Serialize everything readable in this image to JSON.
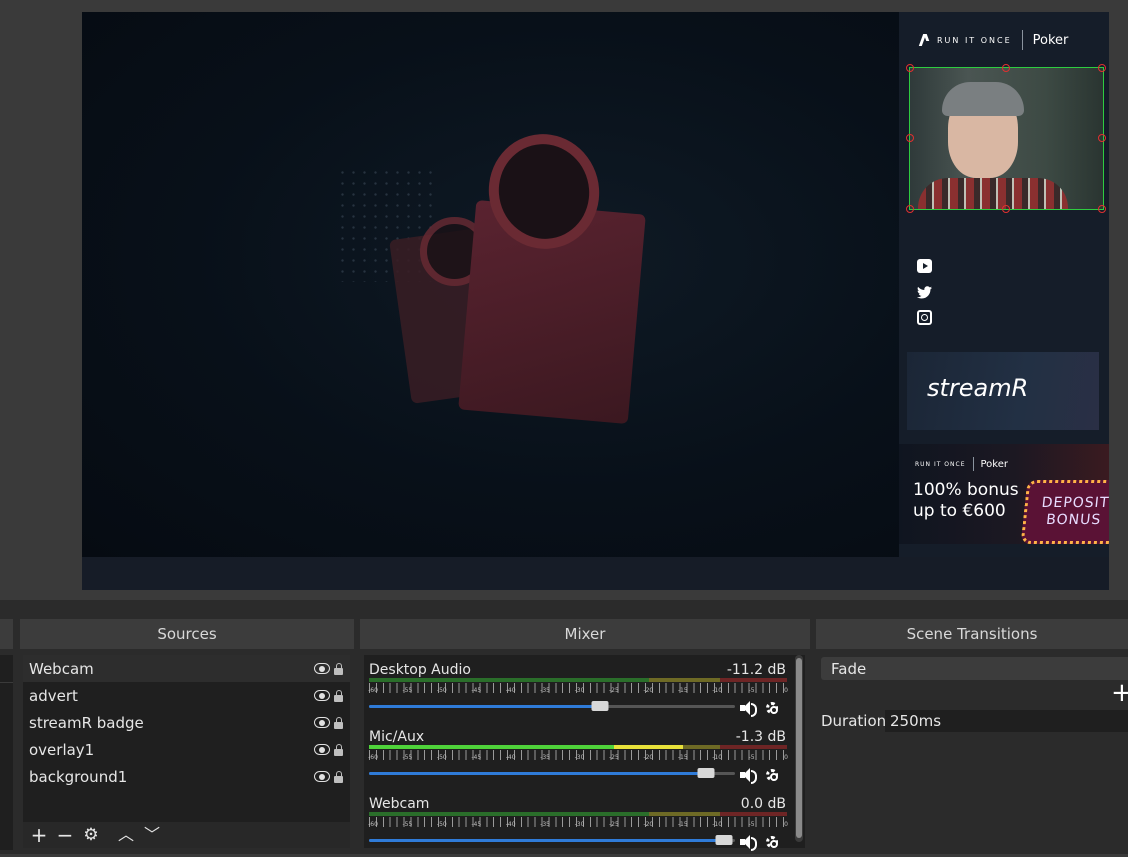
{
  "preview": {
    "brand_text": "RUN IT ONCE",
    "brand_poker": "Poker",
    "streamr_text": "streamR",
    "advert": {
      "brand_text": "RUN IT ONCE",
      "brand_poker": "Poker",
      "line1": "100% bonus",
      "line2": "up to €600",
      "sign_line1": "DEPOSIT",
      "sign_line2": "BONUS"
    },
    "social_icons": [
      "youtube-icon",
      "twitter-icon",
      "instagram-icon"
    ]
  },
  "docks": {
    "sources_title": "Sources",
    "mixer_title": "Mixer",
    "transitions_title": "Scene Transitions"
  },
  "sources": {
    "items": [
      {
        "name": "Webcam",
        "selected": true
      },
      {
        "name": "advert",
        "selected": false
      },
      {
        "name": "streamR badge",
        "selected": false
      },
      {
        "name": "overlay1",
        "selected": false
      },
      {
        "name": "background1",
        "selected": false
      }
    ],
    "toolbar": {
      "add": "+",
      "remove": "−",
      "settings": "⚙",
      "up": "︿",
      "down": "﹀"
    }
  },
  "mixer": {
    "tick_labels": [
      "-60",
      "-55",
      "-50",
      "-45",
      "-40",
      "-35",
      "-30",
      "-25",
      "-20",
      "-15",
      "-10",
      "-5",
      "0"
    ],
    "channels": [
      {
        "name": "Desktop Audio",
        "db": "-11.2 dB",
        "volume": 0.63,
        "level": 0.0
      },
      {
        "name": "Mic/Aux",
        "db": "-1.3 dB",
        "volume": 0.92,
        "level": 0.75
      },
      {
        "name": "Webcam",
        "db": "0.0 dB",
        "volume": 0.97,
        "level": 0.0
      }
    ]
  },
  "transitions": {
    "selected": "Fade",
    "add_label": "+",
    "duration_label": "Duration",
    "duration_value": "250ms"
  },
  "colors": {
    "selection_border": "#2ecc40",
    "slider_blue": "#2f7bd8",
    "meter_green": "#4fd33a",
    "meter_yellow": "#e8e23a"
  }
}
